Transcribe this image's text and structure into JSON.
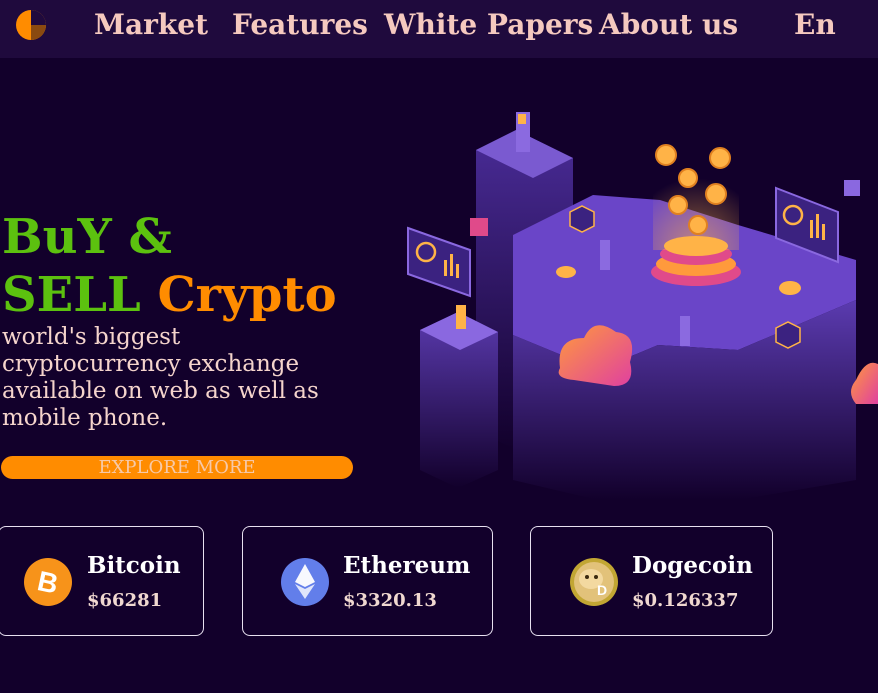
{
  "nav": {
    "links": [
      "Market",
      "Features",
      "White Papers",
      "About us"
    ],
    "language": "En"
  },
  "hero": {
    "title_line1": "BuY &",
    "title_line2_green": "SELL",
    "title_line2_orange": "Crypto",
    "description": "world's biggest cryptocurrency exchange available on web as well as mobile phone.",
    "cta_label": "EXPLORE MORE"
  },
  "coins": [
    {
      "name": "Bitcoin",
      "price": "$66281",
      "icon": "bitcoin-icon",
      "color": "#f7931a"
    },
    {
      "name": "Ethereum",
      "price": "$3320.13",
      "icon": "ethereum-icon",
      "color": "#627eea"
    },
    {
      "name": "Dogecoin",
      "price": "$0.126337",
      "icon": "dogecoin-icon",
      "color": "#c2a633"
    }
  ],
  "colors": {
    "background": "#12002b",
    "nav_background": "#1f0a3d",
    "accent_orange": "#ff8c00",
    "accent_green": "#5cc10f",
    "nav_text": "#f5c9bf"
  }
}
